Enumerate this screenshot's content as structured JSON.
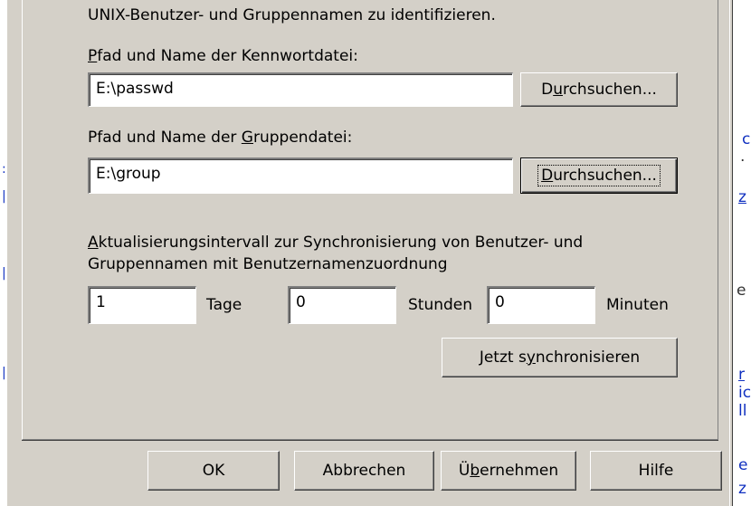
{
  "intro_text": "UNIX-Benutzer- und Gruppennamen zu identifizieren.",
  "passwd": {
    "label_mnemonic": "P",
    "label_rest": "fad und Name der Kennwortdatei:",
    "value": "E:\\passwd",
    "browse_pre": "D",
    "browse_mnemonic": "u",
    "browse_post": "rchsuchen..."
  },
  "group": {
    "label_pre": "Pfad und Name der ",
    "label_mnemonic": "G",
    "label_post": "ruppendatei:",
    "value": "E:\\group",
    "browse_mnemonic": "D",
    "browse_post": "urchsuchen..."
  },
  "interval": {
    "label_mnemonic": "A",
    "label_line1_rest": "ktualisierungsintervall zur Synchronisierung von Benutzer- und",
    "label_line2": "Gruppennamen mit Benutzernamenzuordnung",
    "days_value": "1",
    "days_label": "Tage",
    "hours_value": "0",
    "hours_label": "Stunden",
    "minutes_value": "0",
    "minutes_label": "Minuten"
  },
  "sync_button": {
    "pre": "Jetzt s",
    "mnemonic": "y",
    "post": "nchronisieren"
  },
  "buttons": {
    "ok": "OK",
    "cancel": "Abbrechen",
    "apply_pre": "Ü",
    "apply_mnemonic": "b",
    "apply_post": "ernehmen",
    "help": "Hilfe"
  },
  "background_fragments": [
    "c",
    "z",
    "e",
    "r",
    "ic",
    "ll",
    "e",
    "z"
  ]
}
